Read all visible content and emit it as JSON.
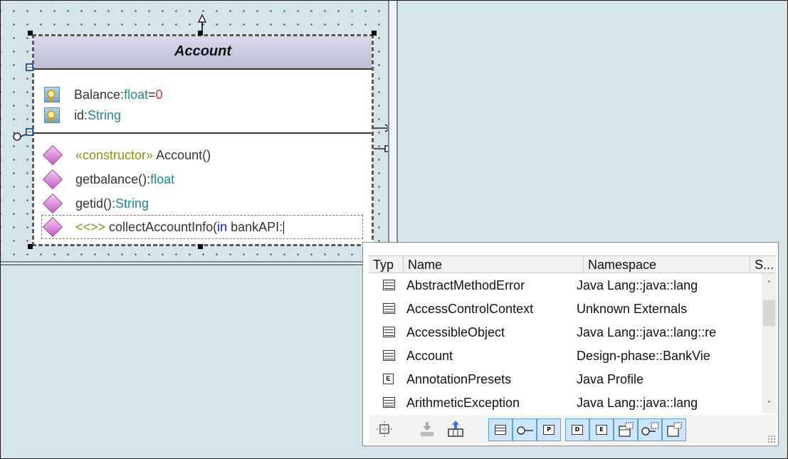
{
  "uml_class": {
    "name": "Account",
    "attributes": [
      {
        "name": "Balance:",
        "type": "float",
        "default_sep": "=",
        "default": "0"
      },
      {
        "name": "id:",
        "type": "String"
      }
    ],
    "operations": [
      {
        "stereotype": "«constructor»",
        "name": " Account()"
      },
      {
        "name": "getbalance():",
        "type": "float"
      },
      {
        "name": "getid():",
        "type": "String"
      }
    ],
    "editing_row": {
      "stereotype": "<<>>",
      "text": " collectAccountInfo(",
      "keyword": "in",
      "param": " bankAPI:"
    }
  },
  "popup": {
    "columns": [
      "Typ",
      "Name",
      "Namespace",
      "S..."
    ],
    "rows": [
      {
        "icon": "class-icon",
        "name": "AbstractMethodError",
        "namespace": "Java Lang::java::lang"
      },
      {
        "icon": "class-icon",
        "name": "AccessControlContext",
        "namespace": "Unknown Externals"
      },
      {
        "icon": "class-icon",
        "name": "AccessibleObject",
        "namespace": "Java Lang::java::lang::re"
      },
      {
        "icon": "class-icon",
        "name": "Account",
        "namespace": "Design-phase::BankVie"
      },
      {
        "icon": "enumeration-icon",
        "name": "AnnotationPresets",
        "namespace": "Java Profile"
      },
      {
        "icon": "class-icon",
        "name": "ArithmeticException",
        "namespace": "Java Lang::java::lang"
      }
    ],
    "toolbar": {
      "icons": [
        "settings-icon",
        "move-down-icon",
        "hierarchy-icon"
      ],
      "filters": [
        "class-filter",
        "interface-filter",
        "primitive-filter",
        "datatype-filter",
        "enumeration-filter",
        "class-template-filter",
        "interface-template-filter",
        "datatype-template-filter"
      ],
      "filter_letters": [
        "",
        "",
        "P",
        "D",
        "E",
        "",
        "",
        ""
      ]
    },
    "enum_letter": "E"
  },
  "colors": {
    "canvas": "#d5e4e8",
    "type_keyword": "#1e8a8a",
    "stereotype": "#8f8f15",
    "in_keyword": "#1a1ad0",
    "default_value": "#c0392b",
    "filter_active": "#cde6ff"
  }
}
